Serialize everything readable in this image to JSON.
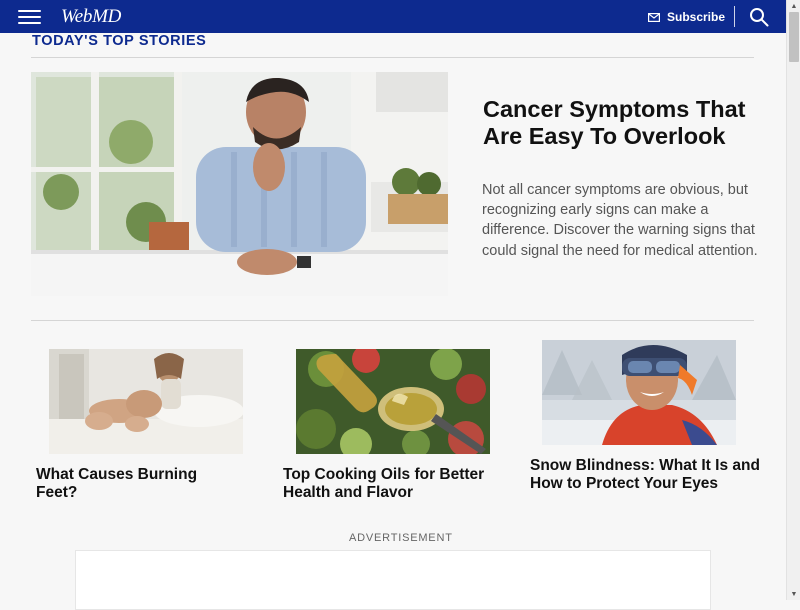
{
  "header": {
    "menu_icon": "hamburger-menu-icon",
    "logo": "WebMD",
    "subscribe_icon": "mail-icon",
    "subscribe_label": "Subscribe",
    "search_icon": "search-icon",
    "background_color": "#0d2a8f"
  },
  "section": {
    "heading": "TODAY'S TOP STORIES",
    "accent_color": "#0d2a8f"
  },
  "hero": {
    "image": "man-coughing-in-kitchen-photo",
    "title": "Cancer Symptoms That Are Easy To Overlook",
    "description": "Not all cancer symptoms are obvious, but recognizing early signs can make a difference. Discover the warning signs that could signal the need for medical attention."
  },
  "cards": [
    {
      "image": "woman-holding-feet-photo",
      "title": "What Causes Burning Feet?"
    },
    {
      "image": "olive-oil-spoon-photo",
      "title": "Top Cooking Oils for Better Health and Flavor"
    },
    {
      "image": "skier-with-goggles-photo",
      "title": "Snow Blindness: What It Is and How to Protect Your Eyes"
    }
  ],
  "advertisement": {
    "label": "ADVERTISEMENT"
  }
}
